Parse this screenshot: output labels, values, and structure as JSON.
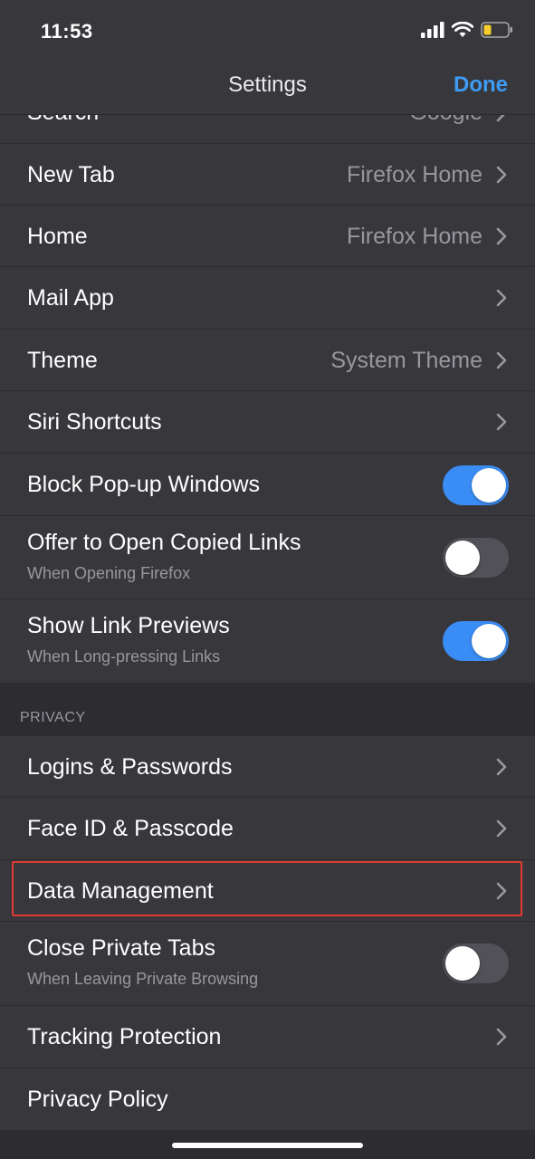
{
  "status_bar": {
    "time": "11:53",
    "signal_icon": "cellular-signal-icon",
    "wifi_icon": "wifi-icon",
    "battery_icon": "battery-low-icon"
  },
  "nav": {
    "title": "Settings",
    "done_label": "Done"
  },
  "colors": {
    "accent": "#3e9cf5",
    "toggle_on": "#3a8df5",
    "highlight": "#e03a2f"
  },
  "rows": {
    "search": {
      "label": "Search",
      "value": "Google"
    },
    "new_tab": {
      "label": "New Tab",
      "value": "Firefox Home"
    },
    "home": {
      "label": "Home",
      "value": "Firefox Home"
    },
    "mail_app": {
      "label": "Mail App"
    },
    "theme": {
      "label": "Theme",
      "value": "System Theme"
    },
    "siri": {
      "label": "Siri Shortcuts"
    },
    "block_popups": {
      "label": "Block Pop-up Windows",
      "on": true
    },
    "offer_copied": {
      "label": "Offer to Open Copied Links",
      "sub": "When Opening Firefox",
      "on": false
    },
    "link_previews": {
      "label": "Show Link Previews",
      "sub": "When Long-pressing Links",
      "on": true
    }
  },
  "privacy": {
    "header": "PRIVACY",
    "logins": {
      "label": "Logins & Passwords"
    },
    "faceid": {
      "label": "Face ID & Passcode"
    },
    "data_mgmt": {
      "label": "Data Management"
    },
    "close_private": {
      "label": "Close Private Tabs",
      "sub": "When Leaving Private Browsing",
      "on": false
    },
    "tracking": {
      "label": "Tracking Protection"
    },
    "privacy_policy": {
      "label": "Privacy Policy"
    }
  }
}
